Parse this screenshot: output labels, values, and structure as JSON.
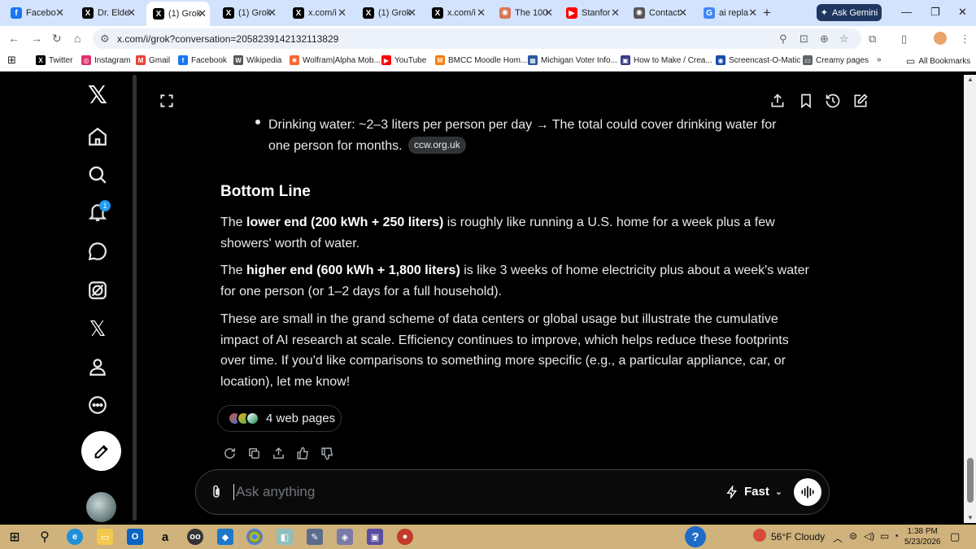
{
  "browser": {
    "tabs": [
      {
        "title": "Facebo",
        "icon": "facebook-icon",
        "color": "#1877f2",
        "glyph": "f"
      },
      {
        "title": "Dr. Elde",
        "icon": "x-icon",
        "color": "#000000",
        "glyph": "X"
      },
      {
        "title": "(1) Grok",
        "icon": "x-icon",
        "color": "#000000",
        "glyph": "X"
      },
      {
        "title": "(1) Grok",
        "icon": "x-icon",
        "color": "#000000",
        "glyph": "X"
      },
      {
        "title": "x.com/i",
        "icon": "x-icon",
        "color": "#000000",
        "glyph": "X"
      },
      {
        "title": "(1) Grok",
        "icon": "x-icon",
        "color": "#000000",
        "glyph": "X"
      },
      {
        "title": "x.com/i",
        "icon": "x-icon",
        "color": "#000000",
        "glyph": "X"
      },
      {
        "title": "The 100",
        "icon": "claude-icon",
        "color": "#d97757",
        "glyph": "✺"
      },
      {
        "title": "Stanfor",
        "icon": "youtube-icon",
        "color": "#ff0000",
        "glyph": "▶"
      },
      {
        "title": "Contact",
        "icon": "openai-icon",
        "color": "#555555",
        "glyph": "✺"
      },
      {
        "title": "ai repla",
        "icon": "google-icon",
        "color": "#4285f4",
        "glyph": "G"
      }
    ],
    "ask_gemini": "Ask Gemini",
    "url": "x.com/i/grok?conversation=2058239142132113829",
    "bookmarks": [
      {
        "label": "Twitter",
        "icon": "x-icon",
        "color": "#000000",
        "glyph": "X"
      },
      {
        "label": "Instagram",
        "icon": "instagram-icon",
        "color": "#e1306c",
        "glyph": "◎"
      },
      {
        "label": "Gmail",
        "icon": "gmail-icon",
        "color": "#ea4335",
        "glyph": "M"
      },
      {
        "label": "Facebook",
        "icon": "facebook-icon",
        "color": "#1877f2",
        "glyph": "f"
      },
      {
        "label": "Wikipedia",
        "icon": "wikipedia-icon",
        "color": "#555555",
        "glyph": "W"
      },
      {
        "label": "Wolfram|Alpha Mob...",
        "icon": "wolfram-icon",
        "color": "#f96932",
        "glyph": "✹"
      },
      {
        "label": "YouTube",
        "icon": "youtube-icon",
        "color": "#ff0000",
        "glyph": "▶"
      },
      {
        "label": "BMCC Moodle Hom...",
        "icon": "moodle-icon",
        "color": "#f98012",
        "glyph": "M"
      },
      {
        "label": "Michigan Voter Info...",
        "icon": "michigan-icon",
        "color": "#2c5aa0",
        "glyph": "▦"
      },
      {
        "label": "How to Make / Crea...",
        "icon": "howto-icon",
        "color": "#3b3b8c",
        "glyph": "▣"
      },
      {
        "label": "Screencast-O-Matic",
        "icon": "screencast-icon",
        "color": "#1a4da8",
        "glyph": "◉"
      },
      {
        "label": "Creamy pages",
        "icon": "folder-icon",
        "color": "#5f6368",
        "glyph": "▭"
      }
    ],
    "all_bookmarks": "All Bookmarks"
  },
  "grok": {
    "bullet_text": "Drinking water: ~2–3 liters per person per day → The total could cover drinking water for one person for months.",
    "bullet_source": "ccw.org.uk",
    "heading": "Bottom Line",
    "p1_pre": "The ",
    "p1_bold": "lower end (200 kWh + 250 liters)",
    "p1_post": " is roughly like running a U.S. home for a week plus a few showers' worth of water.",
    "p2_pre": "The ",
    "p2_bold": "higher end (600 kWh + 1,800 liters)",
    "p2_post": " is like 3 weeks of home electricity plus about a week's water for one person (or 1–2 days for a full household).",
    "p3": "These are small in the grand scheme of data centers or global usage but illustrate the cumulative impact of AI research at scale. Efficiency continues to improve, which helps reduce these footprints over time. If you'd like comparisons to something more specific (e.g., a particular appliance, car, or location), let me know!",
    "web_pages": "4 web pages",
    "input_placeholder": "Ask anything",
    "mode": "Fast"
  },
  "sidebar": {
    "notification_count": "1"
  },
  "taskbar": {
    "weather": "56°F  Cloudy",
    "time": "1:38 PM",
    "date": "5/23/2026"
  }
}
